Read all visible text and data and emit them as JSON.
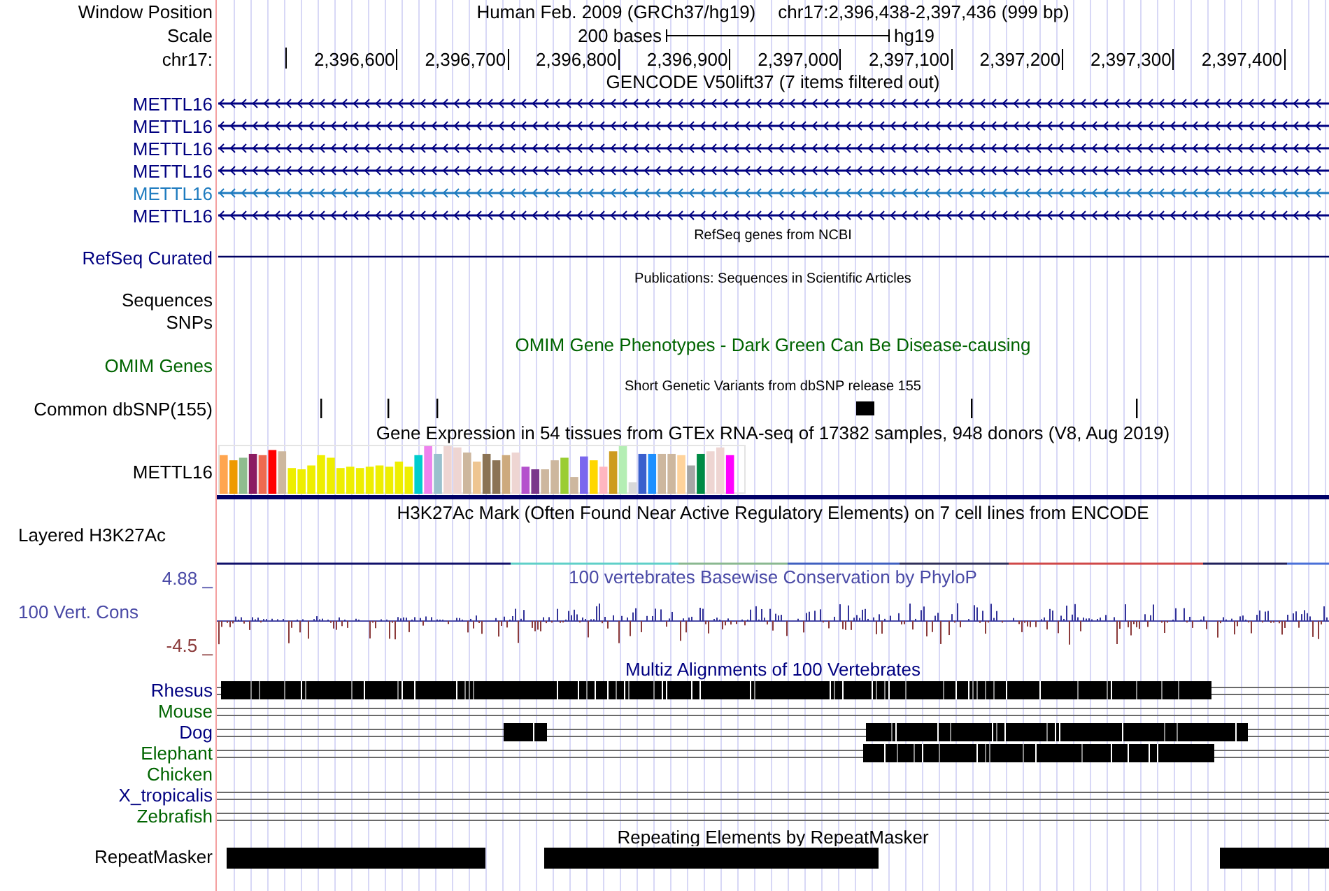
{
  "header": {
    "label": "Window Position",
    "assembly": "Human Feb. 2009 (GRCh37/hg19)",
    "position": "chr17:2,396,438-2,397,436 (999 bp)"
  },
  "scale": {
    "label": "Scale",
    "bar_label": "200 bases",
    "assembly": "hg19"
  },
  "ruler": {
    "label": "chr17:",
    "ticks": [
      "2,396,600",
      "2,396,700",
      "2,396,800",
      "2,396,900",
      "2,397,000",
      "2,397,100",
      "2,397,200",
      "2,397,300",
      "2,397,400"
    ]
  },
  "tracks": [
    {
      "kind": "genes",
      "title": "GENCODE V50lift37 (7 items filtered out)",
      "items": [
        {
          "name": "METTL16",
          "color": "#000080"
        },
        {
          "name": "METTL16",
          "color": "#000080"
        },
        {
          "name": "METTL16",
          "color": "#000080"
        },
        {
          "name": "METTL16",
          "color": "#000080"
        },
        {
          "name": "METTL16",
          "color": "#1e7bbf"
        },
        {
          "name": "METTL16",
          "color": "#000080"
        }
      ]
    },
    {
      "kind": "line",
      "title": "RefSeq genes from NCBI",
      "label": "RefSeq Curated"
    },
    {
      "kind": "empty",
      "title": "Publications: Sequences in Scientific Articles",
      "labels": [
        "Sequences",
        "SNPs"
      ]
    },
    {
      "kind": "omim",
      "title": "OMIM Gene Phenotypes - Dark Green Can Be Disease-causing",
      "label": "OMIM Genes"
    },
    {
      "kind": "snps",
      "title": "Short Genetic Variants from dbSNP release 155",
      "label": "Common dbSNP(155)"
    },
    {
      "kind": "gtex",
      "title": "Gene Expression in 54 tissues from GTEx RNA-seq of 17382 samples, 948 donors (V8, Aug 2019)",
      "label": "METTL16"
    },
    {
      "kind": "signal",
      "title": "H3K27Ac Mark (Often Found Near Active Regulatory Elements) on 7 cell lines from ENCODE",
      "label": "Layered H3K27Ac"
    },
    {
      "kind": "wiggle",
      "title": "100 vertebrates Basewise Conservation by PhyloP",
      "label": "100 Vert. Cons",
      "max": "4.88 _",
      "min": "-4.5 _"
    },
    {
      "kind": "multiz",
      "title": "Multiz Alignments of 100 Vertebrates",
      "species": [
        {
          "name": "Rhesus",
          "color": "#000080"
        },
        {
          "name": "Mouse",
          "color": "#006400"
        },
        {
          "name": "Dog",
          "color": "#000080"
        },
        {
          "name": "Elephant",
          "color": "#006400"
        },
        {
          "name": "Chicken",
          "color": "#006400"
        },
        {
          "name": "X_tropicalis",
          "color": "#000080"
        },
        {
          "name": "Zebrafish",
          "color": "#006400"
        }
      ]
    },
    {
      "kind": "repeats",
      "title": "Repeating Elements by RepeatMasker",
      "label": "RepeatMasker"
    }
  ]
}
